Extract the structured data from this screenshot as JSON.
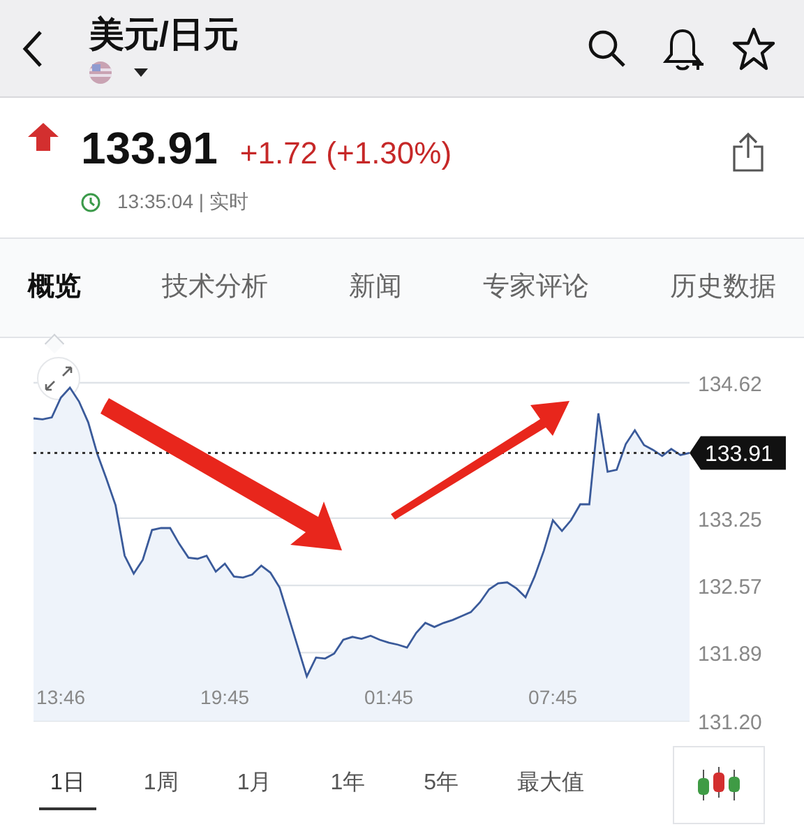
{
  "header": {
    "title": "美元/日元"
  },
  "quote": {
    "up": true,
    "price": "133.91",
    "change": "+1.72 (+1.30%)",
    "time": "13:35:04 | 实时"
  },
  "tabs": [
    {
      "label": "概览",
      "selected": true
    },
    {
      "label": "技术分析",
      "selected": false
    },
    {
      "label": "新闻",
      "selected": false
    },
    {
      "label": "专家评论",
      "selected": false
    },
    {
      "label": "历史数据",
      "selected": false
    }
  ],
  "chart": {
    "chart_data": {
      "type": "area",
      "grid": true,
      "ylim": [
        131.2,
        134.62
      ],
      "categories": [
        null,
        null,
        null,
        "13:46",
        null,
        null,
        null,
        null,
        null,
        null,
        null,
        null,
        null,
        null,
        null,
        null,
        null,
        null,
        null,
        null,
        null,
        "19:45",
        null,
        null,
        null,
        null,
        null,
        null,
        null,
        null,
        null,
        null,
        null,
        null,
        null,
        null,
        null,
        null,
        null,
        "01:45",
        null,
        null,
        null,
        null,
        null,
        null,
        null,
        null,
        null,
        null,
        null,
        null,
        null,
        null,
        null,
        null,
        null,
        "07:45",
        null,
        null,
        null,
        null,
        null,
        null,
        null,
        null,
        null,
        null,
        null,
        null,
        null,
        null,
        null
      ],
      "yticks": [
        {
          "value": 134.62,
          "label": "134.62"
        },
        {
          "value": 133.25,
          "label": "133.25"
        },
        {
          "value": 132.57,
          "label": "132.57"
        },
        {
          "value": 131.89,
          "label": "131.89"
        },
        {
          "value": 131.2,
          "label": "131.20"
        }
      ],
      "series": [
        {
          "color": "#3a5a9a",
          "values": [
            134.26,
            134.25,
            134.27,
            134.47,
            134.57,
            134.43,
            134.22,
            133.9,
            133.65,
            133.38,
            132.87,
            132.69,
            132.83,
            133.13,
            133.15,
            133.15,
            132.99,
            132.85,
            132.84,
            132.87,
            132.71,
            132.79,
            132.66,
            132.65,
            132.68,
            132.77,
            132.7,
            132.55,
            132.25,
            131.95,
            131.65,
            131.84,
            131.83,
            131.88,
            132.02,
            132.05,
            132.03,
            132.06,
            132.02,
            131.99,
            131.97,
            131.94,
            132.09,
            132.19,
            132.15,
            132.19,
            132.22,
            132.26,
            132.3,
            132.4,
            132.53,
            132.59,
            132.6,
            132.54,
            132.45,
            132.66,
            132.92,
            133.23,
            133.12,
            133.23,
            133.39,
            133.39,
            134.31,
            133.72,
            133.74,
            134,
            134.14,
            133.99,
            133.94,
            133.88,
            133.95,
            133.89,
            133.91
          ]
        }
      ],
      "ref_lines": [
        {
          "axis": "y",
          "value": 133.91,
          "label": "133.91"
        }
      ]
    }
  },
  "ranges": [
    {
      "label": "1日",
      "selected": true
    },
    {
      "label": "1周",
      "selected": false
    },
    {
      "label": "1月",
      "selected": false
    },
    {
      "label": "1年",
      "selected": false
    },
    {
      "label": "5年",
      "selected": false
    },
    {
      "label": "最大值",
      "selected": false
    }
  ]
}
